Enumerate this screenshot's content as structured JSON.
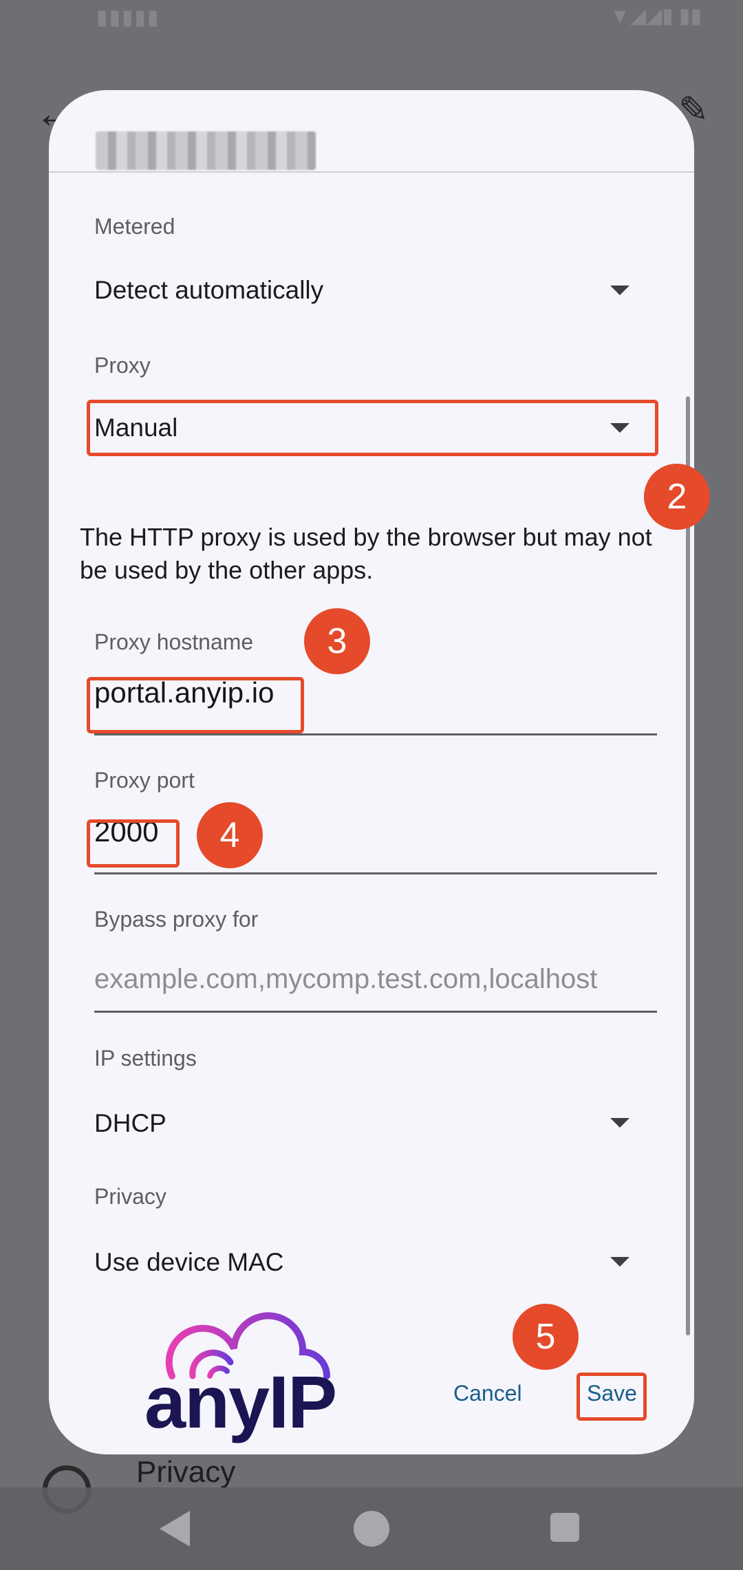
{
  "dialog": {
    "metered": {
      "label": "Metered",
      "value": "Detect automatically"
    },
    "proxy": {
      "label": "Proxy",
      "value": "Manual"
    },
    "note": "The HTTP proxy is used by the browser but may not be used by the other apps.",
    "proxy_hostname": {
      "label": "Proxy hostname",
      "value": "portal.anyip.io"
    },
    "proxy_port": {
      "label": "Proxy port",
      "value": "2000"
    },
    "bypass": {
      "label": "Bypass proxy for",
      "placeholder": "example.com,mycomp.test.com,localhost"
    },
    "ip_settings": {
      "label": "IP settings",
      "value": "DHCP"
    },
    "privacy": {
      "label": "Privacy",
      "value": "Use device MAC"
    },
    "buttons": {
      "cancel": "Cancel",
      "save": "Save"
    }
  },
  "logo": {
    "text": "anyIP"
  },
  "callouts": {
    "c2": "2",
    "c3": "3",
    "c4": "4",
    "c5": "5"
  },
  "background": {
    "privacy_label": "Privacy"
  },
  "colors": {
    "accent": "#e54a2a",
    "button": "#1a5d8a",
    "dialog_bg": "#f5f5fb",
    "logo_dark": "#1b1553"
  }
}
